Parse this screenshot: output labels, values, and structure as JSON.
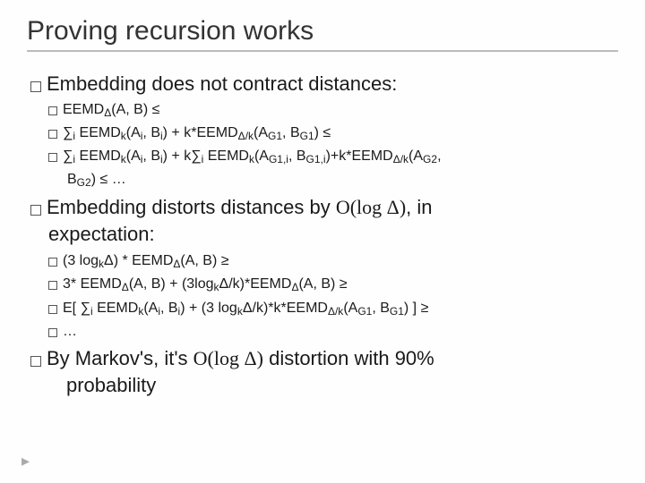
{
  "title": "Proving recursion works",
  "b1": {
    "l1": "Embedding does not contract distances:",
    "s": [
      {
        "html": "EEMD<span class='sub'>Δ</span>(A, B) ≤"
      },
      {
        "html": "∑<span class='sub'>i</span> EEMD<span class='sub'>k</span>(A<span class='sub'>i</span>, B<span class='sub'>i</span>) + k*EEMD<span class='sub'>Δ/k</span>(A<span class='sub'>G1</span>, B<span class='sub'>G1</span>) ≤"
      },
      {
        "html": "∑<span class='sub'>i</span> EEMD<span class='sub'>k</span>(A<span class='sub'>i</span>, B<span class='sub'>i</span>) + k∑<span class='sub'>i</span> EEMD<span class='sub'>k</span>(A<span class='sub'>G1,i</span>, B<span class='sub'>G1,i</span>)+k*EEMD<span class='sub'>Δ/k</span>(A<span class='sub'>G2</span>,",
        "cont": "B<span class='sub'>G2</span>) ≤ …"
      }
    ]
  },
  "b2": {
    "l1a": "Embedding distorts distances by ",
    "l1b": "O(log Δ)",
    "l1c": ", in",
    "l1cont": "expectation:",
    "s": [
      {
        "html": "(3 log<span class='sub'>k</span>Δ) * EEMD<span class='sub'>Δ</span>(A, B) ≥"
      },
      {
        "html": "3* EEMD<span class='sub'>Δ</span>(A, B) + (3log<span class='sub'>k</span>Δ/k)*EEMD<span class='sub'>Δ</span>(A, B) ≥"
      },
      {
        "html": "E[ ∑<span class='sub'>i</span> EEMD<span class='sub'>k</span>(A<span class='sub'>i</span>, B<span class='sub'>i</span>) + (3 log<span class='sub'>k</span>Δ/k)*k*EEMD<span class='sub'>Δ/k</span>(A<span class='sub'>G1</span>, B<span class='sub'>G1</span>) ] ≥"
      },
      {
        "html": "…"
      }
    ]
  },
  "b3": {
    "l1a": "By Markov's, it's ",
    "l1b": "O(log Δ)",
    "l1c": " distortion with 90%",
    "l1cont": "probability"
  },
  "arrow": "▸"
}
